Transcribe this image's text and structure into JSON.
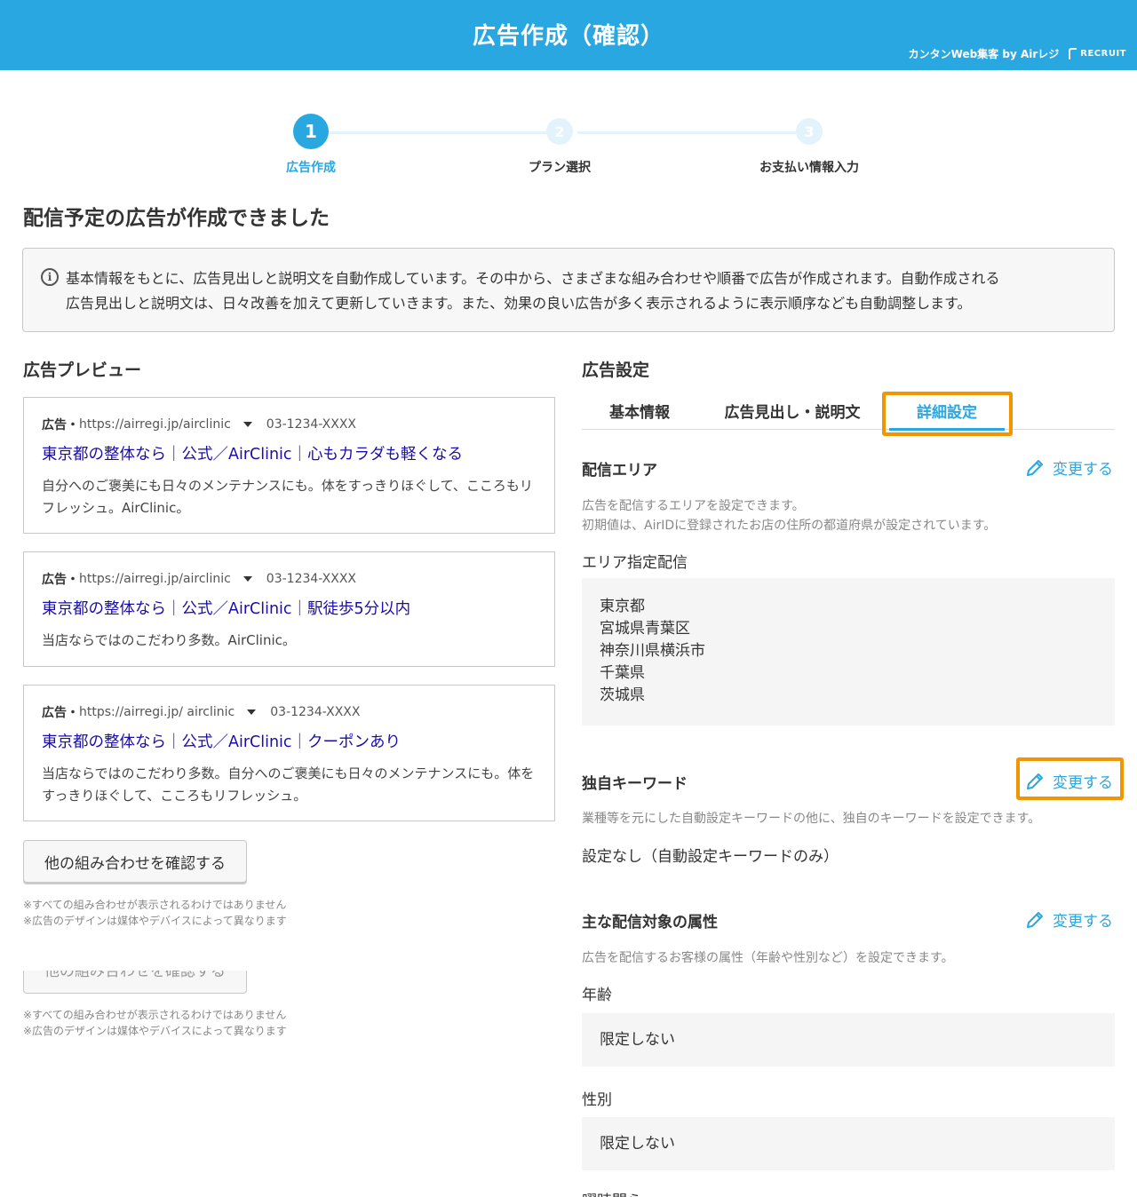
{
  "header": {
    "title": "広告作成（確認）",
    "brand": "カンタンWeb集客 by Airレジ",
    "brand_logo": "RECRUIT"
  },
  "stepper": {
    "steps": [
      {
        "number": "1",
        "label": "広告作成",
        "state": "active"
      },
      {
        "number": "2",
        "label": "プラン選択",
        "state": "inactive"
      },
      {
        "number": "3",
        "label": "お支払い情報入力",
        "state": "inactive"
      }
    ]
  },
  "page_title": "配信予定の広告が作成できました",
  "info": {
    "icon": "info-icon",
    "line1": "基本情報をもとに、広告見出しと説明文を自動作成しています。その中から、さまざまな組み合わせや順番で広告が作成されます。自動作成される",
    "line2": "広告見出しと説明文は、日々改善を加えて更新していきます。また、効果の良い広告が多く表示されるように表示順序なども自動調整します。"
  },
  "preview": {
    "title": "広告プレビュー",
    "ads": [
      {
        "label": "広告・",
        "url": "https://airregi.jp/airclinic",
        "phone": "03-1234-XXXX",
        "headline": "東京都の整体なら｜公式／AirClinic｜心もカラダも軽くなる",
        "desc": "自分へのご褒美にも日々のメンテナンスにも。体をすっきりほぐして、こころもリフレッシュ。AirClinic。"
      },
      {
        "label": "広告・",
        "url": "https://airregi.jp/airclinic",
        "phone": "03-1234-XXXX",
        "headline": "東京都の整体なら｜公式／AirClinic｜駅徒歩5分以内",
        "desc": "当店ならではのこだわり多数。AirClinic。"
      },
      {
        "label": "広告・",
        "url": "https://airregi.jp/ airclinic",
        "phone": "03-1234-XXXX",
        "headline": "東京都の整体なら｜公式／AirClinic｜クーポンあり",
        "desc": "当店ならではのこだわり多数。自分へのご褒美にも日々のメンテナンスにも。体をすっきりほぐして、こころもリフレッシュ。"
      }
    ],
    "more_button": "他の組み合わせを確認する",
    "note1": "※すべての組み合わせが表示されるわけではありません",
    "note2": "※広告のデザインは媒体やデバイスによって異なります"
  },
  "settings": {
    "title": "広告設定",
    "tabs": [
      {
        "label": "基本情報",
        "active": false
      },
      {
        "label": "広告見出し・説明文",
        "active": false
      },
      {
        "label": "詳細設定",
        "active": true
      }
    ],
    "change_label": "変更する",
    "area": {
      "title": "配信エリア",
      "desc1": "広告を配信するエリアを設定できます。",
      "desc2": "初期値は、AirIDに登録されたお店の住所の都道府県が設定されています。",
      "label": "エリア指定配信",
      "items": [
        "東京都",
        "宮城県青葉区",
        "神奈川県横浜市",
        "千葉県",
        "茨城県"
      ]
    },
    "keyword": {
      "title": "独自キーワード",
      "desc": "業種等を元にした自動設定キーワードの他に、独自のキーワードを設定できます。",
      "value": "設定なし（自動設定キーワードのみ）"
    },
    "audience": {
      "title": "主な配信対象の属性",
      "desc": "広告を配信するお客様の属性（年齢や性別など）を設定できます。",
      "age_label": "年齢",
      "age_value": "限定しない",
      "gender_label": "性別",
      "gender_value": "限定しない",
      "next_label": "曜時間ら"
    }
  },
  "colors": {
    "accent": "#29a7e1",
    "highlight": "#f29600",
    "ad_link": "#1a0dab"
  }
}
